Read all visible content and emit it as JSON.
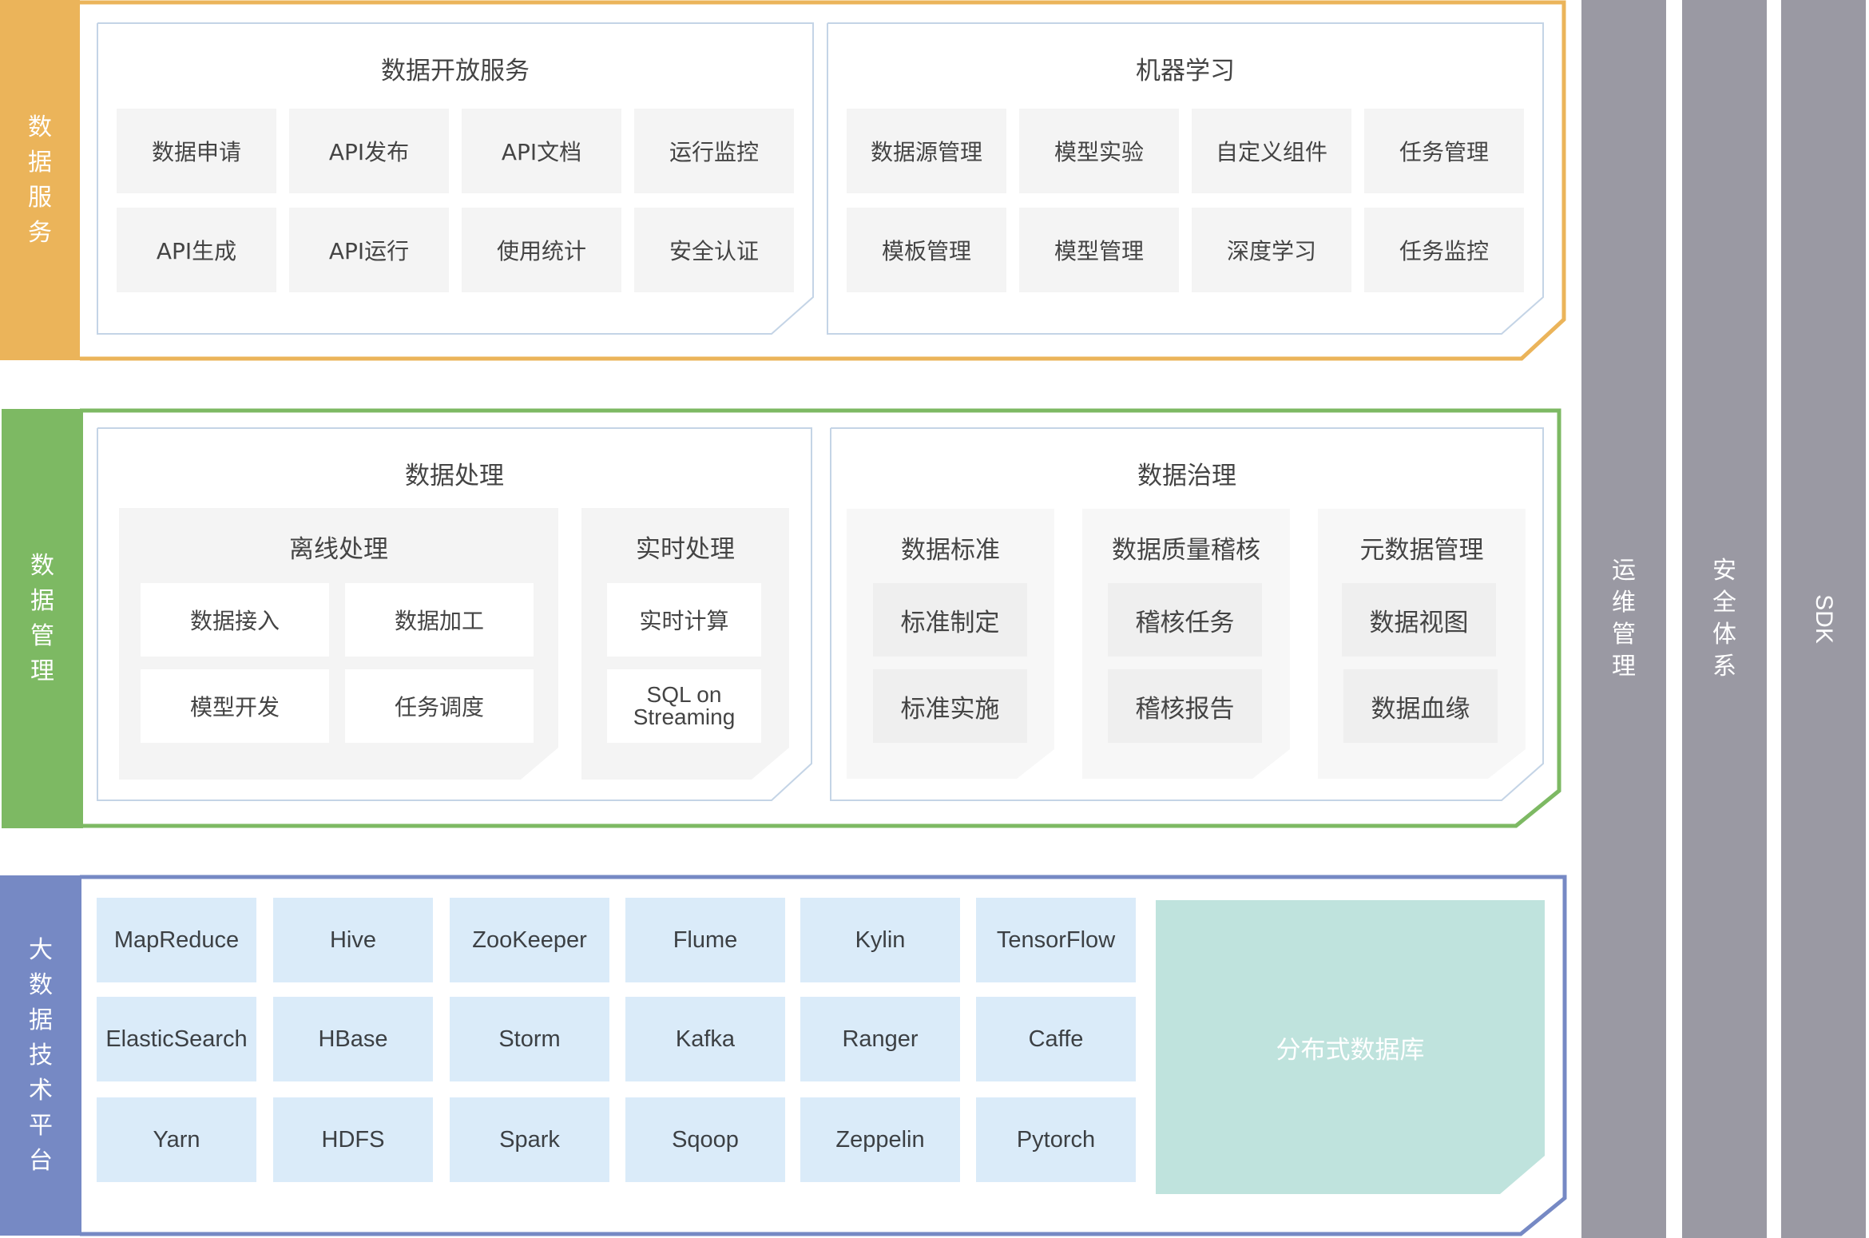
{
  "colors": {
    "data_service": "#ebb45a",
    "data_management": "#7db963",
    "big_data_platform": "#7689c4",
    "side_bar": "#9a99a3",
    "inner_border": "#c4d4e6",
    "tile_gray": "#f4f4f4",
    "tile_blue": "#daebf9",
    "distributed_db": "#bfe3dd"
  },
  "layers": {
    "data_service": {
      "label": [
        "数",
        "据",
        "服",
        "务"
      ],
      "panels": [
        {
          "title": "数据开放服务",
          "items": [
            "数据申请",
            "API发布",
            "API文档",
            "运行监控",
            "API生成",
            "API运行",
            "使用统计",
            "安全认证"
          ]
        },
        {
          "title": "机器学习",
          "items": [
            "数据源管理",
            "模型实验",
            "自定义组件",
            "任务管理",
            "模板管理",
            "模型管理",
            "深度学习",
            "任务监控"
          ]
        }
      ]
    },
    "data_management": {
      "label": [
        "数",
        "据",
        "管",
        "理"
      ],
      "processing": {
        "title": "数据处理",
        "offline": {
          "title": "离线处理",
          "items": [
            "数据接入",
            "数据加工",
            "模型开发",
            "任务调度"
          ]
        },
        "realtime": {
          "title": "实时处理",
          "items": [
            "实时计算",
            "SQL on Streaming"
          ]
        }
      },
      "governance": {
        "title": "数据治理",
        "groups": [
          {
            "title": "数据标准",
            "items": [
              "标准制定",
              "标准实施"
            ]
          },
          {
            "title": "数据质量稽核",
            "items": [
              "稽核任务",
              "稽核报告"
            ]
          },
          {
            "title": "元数据管理",
            "items": [
              "数据视图",
              "数据血缘"
            ]
          }
        ]
      }
    },
    "big_data_platform": {
      "label": [
        "大",
        "数",
        "据",
        "技",
        "术",
        "平",
        "台"
      ],
      "items": [
        "MapReduce",
        "Hive",
        "ZooKeeper",
        "Flume",
        "Kylin",
        "TensorFlow",
        "ElasticSearch",
        "HBase",
        "Storm",
        "Kafka",
        "Ranger",
        "Caffe",
        "Yarn",
        "HDFS",
        "Spark",
        "Sqoop",
        "Zeppelin",
        "Pytorch"
      ],
      "distributed_db": "分布式数据库"
    }
  },
  "side_columns": [
    {
      "label": [
        "运",
        "维",
        "管",
        "理"
      ]
    },
    {
      "label": [
        "安",
        "全",
        "体",
        "系"
      ]
    },
    {
      "label": "SDK"
    }
  ]
}
